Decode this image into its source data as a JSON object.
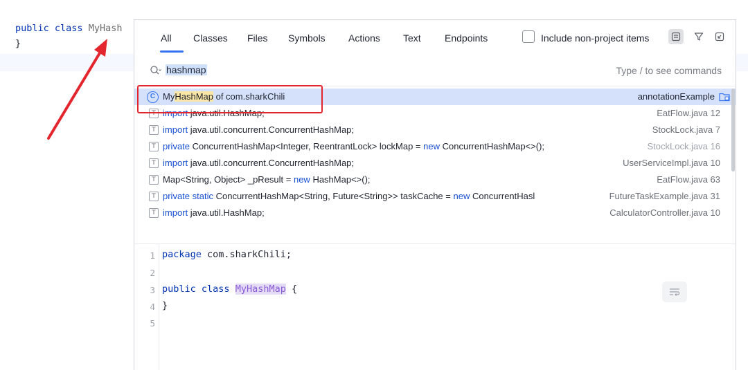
{
  "editor": {
    "line1_kw": "public class",
    "line1_cls": "MyHash",
    "line2": "}"
  },
  "popup": {
    "tabs": [
      "All",
      "Classes",
      "Files",
      "Symbols",
      "Actions",
      "Text",
      "Endpoints"
    ],
    "include_label": "Include non-project items",
    "toolbar_icons": [
      "preview-icon",
      "filter-icon",
      "collapse-icon"
    ],
    "search": {
      "value": "hashmap",
      "hint": "Type / to see commands"
    },
    "results": [
      {
        "kw": "",
        "pre": "My",
        "hl": "HashMap",
        "post": " of com.sharkChili",
        "kw2": "",
        "post2": "",
        "kw3": "",
        "post3": "",
        "location": "annotationExample",
        "type": "class"
      },
      {
        "kw": "import",
        "pre": " java.util.HashMap;",
        "hl": "",
        "post": "",
        "kw2": "",
        "post2": "",
        "kw3": "",
        "post3": "",
        "location": "EatFlow.java 12",
        "type": "text"
      },
      {
        "kw": "import",
        "pre": " java.util.concurrent.ConcurrentHashMap;",
        "hl": "",
        "post": "",
        "kw2": "",
        "post2": "",
        "kw3": "",
        "post3": "",
        "location": "StockLock.java 7",
        "type": "text"
      },
      {
        "kw": "private",
        "pre": " ConcurrentHashMap<Integer, ReentrantLock> lockMap = ",
        "hl": "",
        "post": "",
        "kw2": "new",
        "post2": " ConcurrentHashMap<>();",
        "kw3": "",
        "post3": "",
        "location": "StockLock.java 16",
        "type": "text"
      },
      {
        "kw": "import",
        "pre": " java.util.concurrent.ConcurrentHashMap;",
        "hl": "",
        "post": "",
        "kw2": "",
        "post2": "",
        "kw3": "",
        "post3": "",
        "location": "UserServiceImpl.java 10",
        "type": "text"
      },
      {
        "kw": "",
        "pre": "Map<String, Object> _pResult = ",
        "hl": "",
        "post": "",
        "kw2": "new",
        "post2": " HashMap<>();",
        "kw3": "",
        "post3": "",
        "location": "EatFlow.java 63",
        "type": "text"
      },
      {
        "kw": "private static",
        "pre": " ConcurrentHashMap<String, Future<String>> taskCache = ",
        "hl": "",
        "post": "",
        "kw2": "new",
        "post2": " ConcurrentHasl",
        "kw3": "",
        "post3": "",
        "location": "FutureTaskExample.java 31",
        "type": "text"
      },
      {
        "kw": "import",
        "pre": " java.util.HashMap;",
        "hl": "",
        "post": "",
        "kw2": "",
        "post2": "",
        "kw3": "",
        "post3": "",
        "location": "CalculatorController.java 10",
        "type": "text"
      }
    ],
    "preview": {
      "line_numbers": [
        "1",
        "2",
        "3",
        "4",
        "5"
      ],
      "line1_kw": "package",
      "line1_rest": " com.sharkChili;",
      "line3_kw": "public class",
      "line3_cls": "MyHashMap",
      "line3_rest": " {",
      "line4": "}"
    }
  },
  "colors": {
    "accent": "#3574f0",
    "selection": "#d5e1fb",
    "highlight": "#fbe7a5",
    "annotation_red": "#e3262d",
    "keyword": "#1750d4"
  }
}
